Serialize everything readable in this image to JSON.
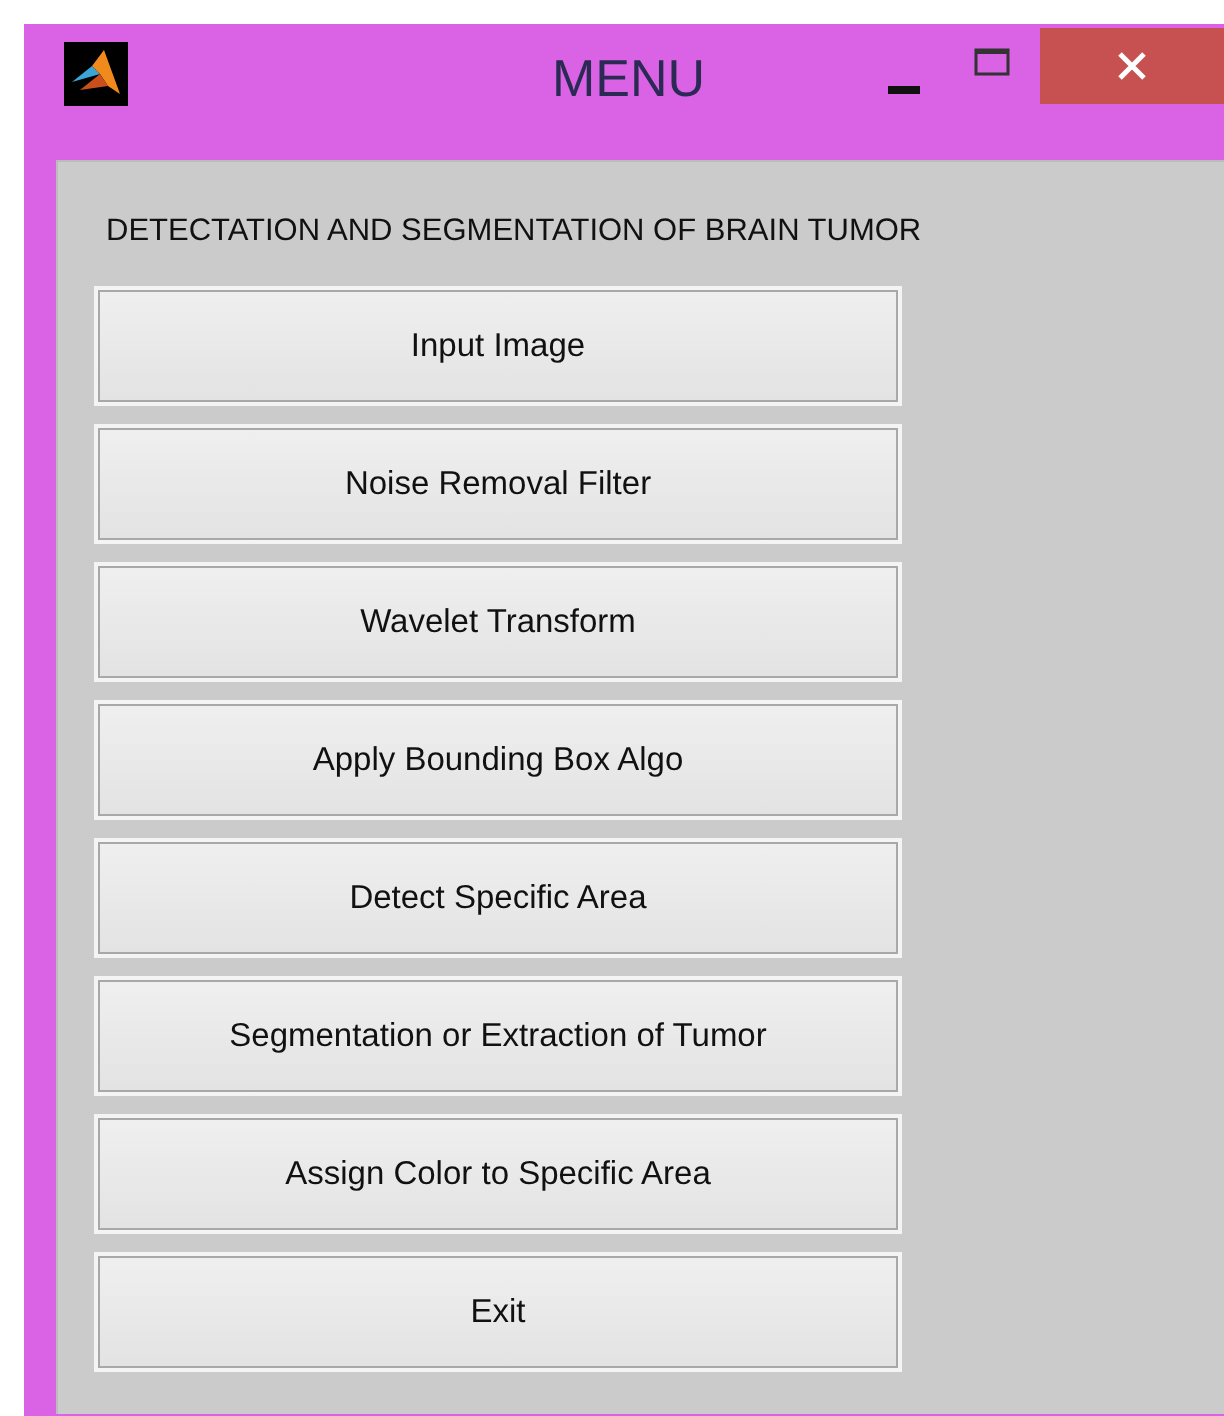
{
  "window": {
    "title": "MENU"
  },
  "heading": "DETECTATION AND SEGMENTATION OF BRAIN TUMOR",
  "buttons": [
    "Input Image",
    "Noise Removal Filter",
    "Wavelet Transform",
    "Apply Bounding Box Algo",
    "Detect Specific Area",
    "Segmentation or Extraction of Tumor",
    "Assign Color to Specific Area",
    "Exit"
  ]
}
